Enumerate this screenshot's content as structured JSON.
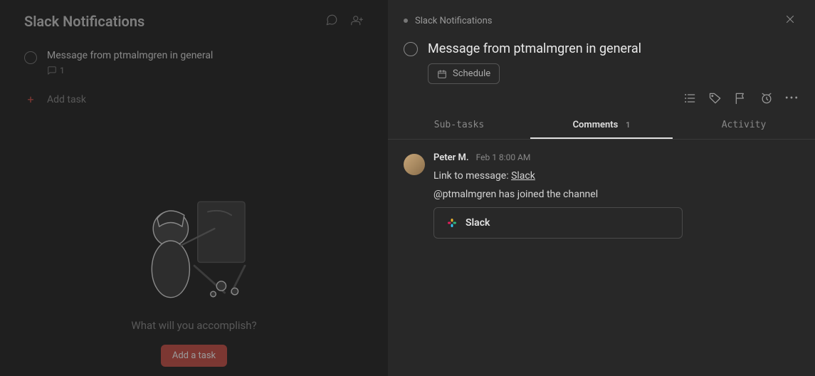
{
  "left": {
    "title": "Slack Notifications",
    "task": {
      "title": "Message from ptmalmgren in general",
      "comment_count": "1"
    },
    "add_task_label": "Add task",
    "empty_caption": "What will you accomplish?",
    "empty_cta": "Add a task"
  },
  "detail": {
    "breadcrumb": "Slack Notifications",
    "title": "Message from ptmalmgren in general",
    "schedule_label": "Schedule",
    "tabs": {
      "subtasks": "Sub-tasks",
      "comments": "Comments",
      "comments_count": "1",
      "activity": "Activity"
    },
    "comment": {
      "author": "Peter M.",
      "time": "Feb 1 8:00 AM",
      "link_prefix": "Link to message: ",
      "link_text": "Slack",
      "body": "@ptmalmgren has joined the channel",
      "attachment": "Slack"
    }
  }
}
